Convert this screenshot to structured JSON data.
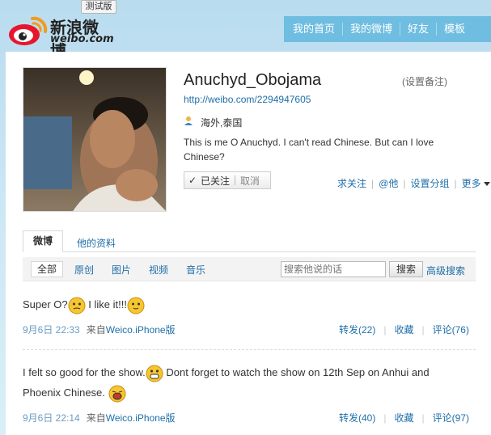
{
  "header": {
    "logo_cn": "新浪微博",
    "logo_en": "weibo.com",
    "beta_badge": "测试版",
    "nav": [
      "我的首页",
      "我的微博",
      "好友",
      "模板"
    ]
  },
  "profile": {
    "name": "Anuchyd_Obojama",
    "remark_link": "(设置备注)",
    "url": "http://weibo.com/2294947605",
    "location": "海外,泰国",
    "bio": "This is me O Anuchyd. I can't read Chinese. But can I love Chinese?",
    "followed_label": "已关注",
    "cancel_label": "取消",
    "actions": [
      "求关注",
      "@他",
      "设置分组",
      "更多"
    ]
  },
  "tabs": {
    "active": "微博",
    "other": "他的资料"
  },
  "filters": {
    "items": [
      "全部",
      "原创",
      "图片",
      "视频",
      "音乐"
    ],
    "search_placeholder": "搜索他说的话",
    "search_button": "搜索",
    "advanced_search": "高级搜索"
  },
  "posts": [
    {
      "text_a": "Super O?",
      "text_b": " I like it!!!",
      "date": "9月6日 22:33",
      "from_label": "来自",
      "source": "Weico.iPhone版",
      "forward": "转发(22)",
      "favorite": "收藏",
      "comment": "评论(76)"
    },
    {
      "text_a": "I felt so good for the show.",
      "text_b": " Dont forget to watch the show on 12th Sep on Anhui and",
      "text_c": "Phoenix Chinese.",
      "date": "9月6日 22:14",
      "from_label": "来自",
      "source": "Weico.iPhone版",
      "forward": "转发(40)",
      "favorite": "收藏",
      "comment": "评论(97)"
    }
  ],
  "colors": {
    "link": "#1f6fa8",
    "nav_bg": "#6fbde0",
    "page_bg": "#b9dcef"
  }
}
